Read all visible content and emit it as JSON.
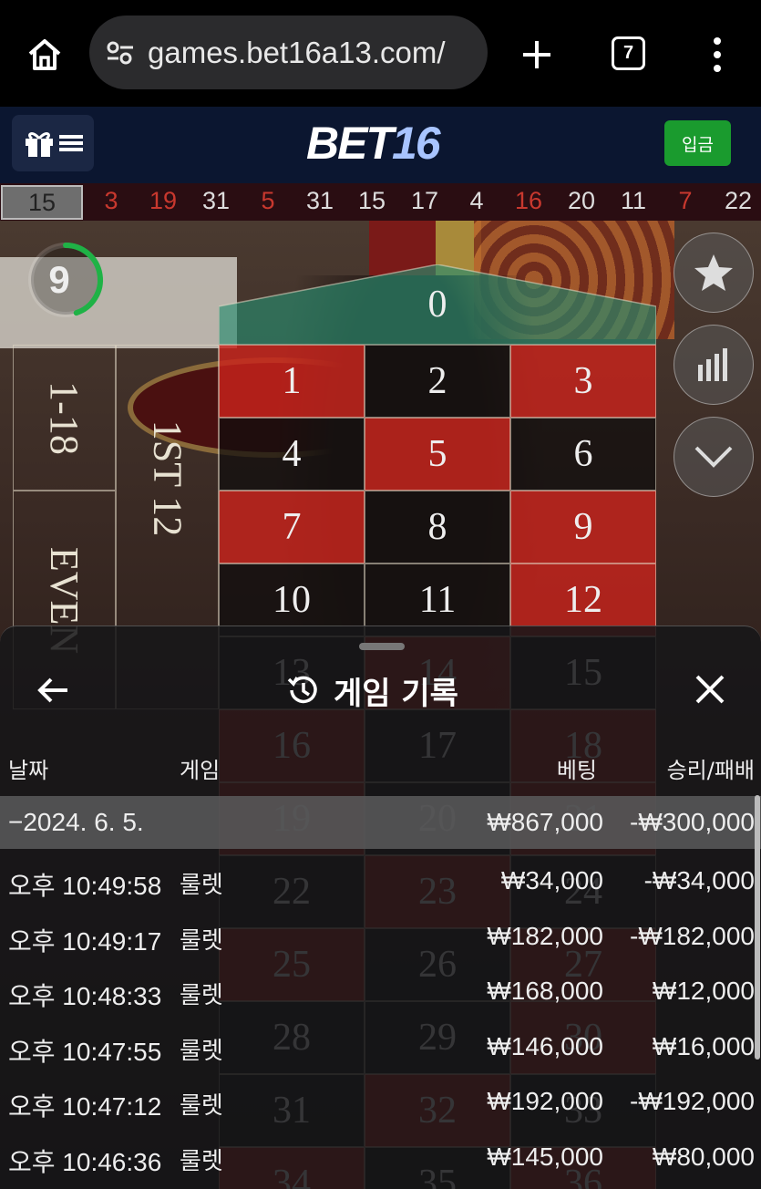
{
  "browser": {
    "url": "games.bet16a13.com/",
    "tab_count": "7"
  },
  "header": {
    "logo_white": "BET",
    "logo_blue": "16",
    "deposit_label": "입금"
  },
  "recent_results": [
    "15",
    "3",
    "19",
    "31",
    "5",
    "31",
    "15",
    "17",
    "4",
    "16",
    "20",
    "11",
    "7",
    "22"
  ],
  "recent_colors": [
    "#cfcfcf",
    "#c8382e",
    "#c8382e",
    "#dddddd",
    "#c8382e",
    "#dddddd",
    "#dddddd",
    "#dddddd",
    "#dddddd",
    "#c8382e",
    "#dddddd",
    "#dddddd",
    "#c8382e",
    "#dddddd"
  ],
  "timer": {
    "value": "9",
    "fraction": 0.45
  },
  "board": {
    "zero": "0",
    "numbers": [
      "1",
      "2",
      "3",
      "4",
      "5",
      "6",
      "7",
      "8",
      "9",
      "10",
      "11",
      "12",
      "13",
      "14",
      "15",
      "16",
      "17",
      "18",
      "19",
      "20",
      "21",
      "22",
      "23",
      "24",
      "25",
      "26",
      "27",
      "28",
      "29",
      "30",
      "31",
      "32",
      "33",
      "34",
      "35",
      "36"
    ],
    "colors": [
      "red",
      "black",
      "red",
      "black",
      "red",
      "black",
      "red",
      "black",
      "red",
      "black",
      "black",
      "red",
      "black",
      "red",
      "black",
      "red",
      "black",
      "red",
      "red",
      "black",
      "red",
      "black",
      "red",
      "black",
      "red",
      "black",
      "red",
      "black",
      "black",
      "red",
      "black",
      "red",
      "black",
      "red",
      "black",
      "red"
    ],
    "side_low": "1-18",
    "side_even": "EVEN",
    "dozen": "1ST 12"
  },
  "history": {
    "title": "게임 기록",
    "columns": {
      "date": "날짜",
      "game": "게임",
      "bet": "베팅",
      "result": "승리/패배"
    },
    "date_group": {
      "label": "−2024. 6. 5.",
      "bet": "₩867,000",
      "result": "-₩300,000"
    },
    "rows": [
      {
        "time": "오후 10:49:58",
        "game": "룰렛",
        "bet": "₩34,000",
        "result": "-₩34,000"
      },
      {
        "time": "오후 10:49:17",
        "game": "룰렛",
        "bet": "₩182,000",
        "result": "-₩182,000"
      },
      {
        "time": "오후 10:48:33",
        "game": "룰렛",
        "bet": "₩168,000",
        "result": "₩12,000"
      },
      {
        "time": "오후 10:47:55",
        "game": "룰렛",
        "bet": "₩146,000",
        "result": "₩16,000"
      },
      {
        "time": "오후 10:47:12",
        "game": "룰렛",
        "bet": "₩192,000",
        "result": "-₩192,000"
      },
      {
        "time": "오후 10:46:36",
        "game": "룰렛",
        "bet": "₩145,000",
        "result": "₩80,000"
      }
    ]
  },
  "icons": [
    "home-icon",
    "site-settings-icon",
    "new-tab-icon",
    "tabs-icon",
    "more-menu-icon",
    "gift-menu-icon",
    "star-icon",
    "stats-icon",
    "chevron-down-icon",
    "back-arrow-icon",
    "history-icon",
    "close-icon"
  ]
}
